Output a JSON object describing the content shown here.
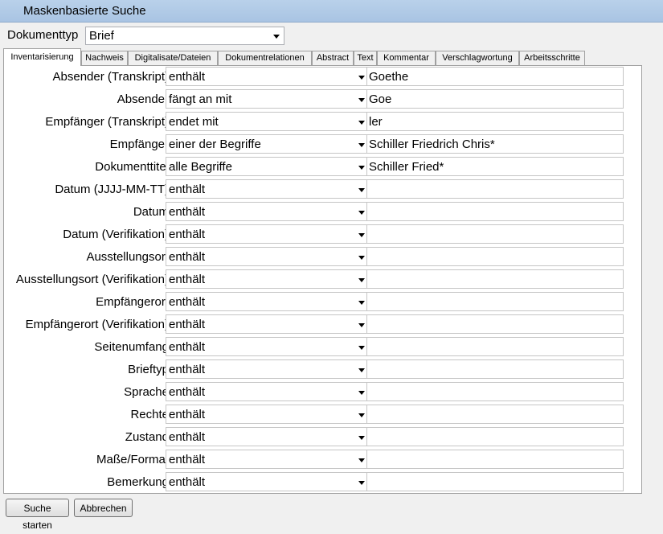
{
  "window": {
    "title": "Maskenbasierte Suche"
  },
  "doctype": {
    "label": "Dokumenttyp",
    "value": "Brief"
  },
  "tabs": [
    {
      "label": "Inventarisierung",
      "active": true
    },
    {
      "label": "Nachweis"
    },
    {
      "label": "Digitalisate/Dateien"
    },
    {
      "label": "Dokumentrelationen"
    },
    {
      "label": "Abstract"
    },
    {
      "label": "Text"
    },
    {
      "label": "Kommentar"
    },
    {
      "label": "Verschlagwortung"
    },
    {
      "label": "Arbeitsschritte"
    }
  ],
  "rows": [
    {
      "label": "Absender (Transkript)",
      "op": "enthält",
      "term": "Goethe"
    },
    {
      "label": "Absender",
      "op": "fängt an mit",
      "term": "Goe"
    },
    {
      "label": "Empfänger (Transkript)",
      "op": "endet mit",
      "term": "ler"
    },
    {
      "label": "Empfänger",
      "op": "einer der Begriffe",
      "term": "Schiller Friedrich Chris*"
    },
    {
      "label": "Dokumenttitel",
      "op": "alle Begriffe",
      "term": "Schiller Fried*"
    },
    {
      "label": "Datum (JJJJ-MM-TT)",
      "op": "enthält",
      "term": ""
    },
    {
      "label": "Datum",
      "op": "enthält",
      "term": ""
    },
    {
      "label": "Datum (Verifikation)",
      "op": "enthält",
      "term": ""
    },
    {
      "label": "Ausstellungsort",
      "op": "enthält",
      "term": ""
    },
    {
      "label": "Ausstellungsort (Verifikation)",
      "op": "enthält",
      "term": ""
    },
    {
      "label": "Empfängerort",
      "op": "enthält",
      "term": ""
    },
    {
      "label": "Empfängerort (Verifikation)",
      "op": "enthält",
      "term": ""
    },
    {
      "label": "Seitenumfang",
      "op": "enthält",
      "term": ""
    },
    {
      "label": "Brieftyp",
      "op": "enthält",
      "term": ""
    },
    {
      "label": "Sprache",
      "op": "enthält",
      "term": ""
    },
    {
      "label": "Rechte",
      "op": "enthält",
      "term": ""
    },
    {
      "label": "Zustand",
      "op": "enthält",
      "term": ""
    },
    {
      "label": "Maße/Format",
      "op": "enthält",
      "term": ""
    },
    {
      "label": "Bemerkung",
      "op": "enthält",
      "term": ""
    }
  ],
  "buttons": {
    "start": "Suche starten",
    "cancel": "Abbrechen"
  }
}
